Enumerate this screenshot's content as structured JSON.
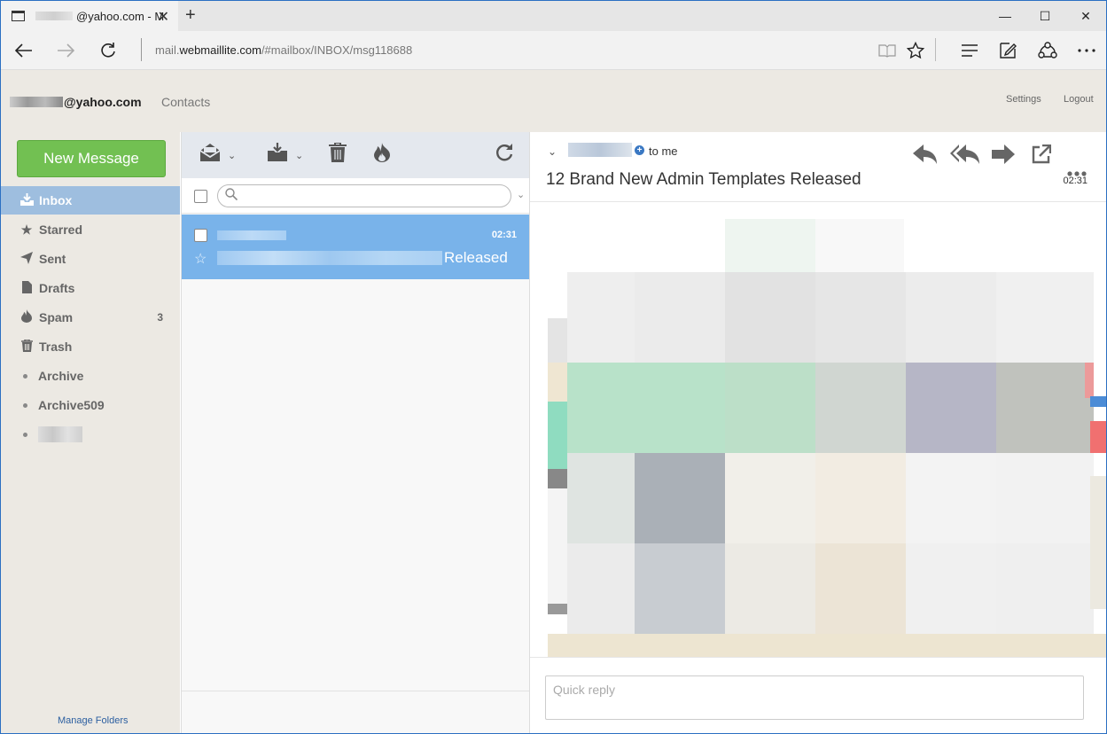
{
  "browser": {
    "tab_title": "@yahoo.com - M",
    "tab_close": "✕",
    "new_tab": "+",
    "window_controls": [
      "—",
      "☐",
      "✕"
    ],
    "address_prefix": "mail.",
    "address_domain": "webmaillite.com",
    "address_path": "/#mailbox/INBOX/msg118688",
    "icons": [
      "back-icon",
      "forward-icon",
      "refresh-icon",
      "reading-view-icon",
      "favorite-star-icon",
      "hub-icon",
      "web-note-icon",
      "share-icon",
      "more-icon"
    ]
  },
  "header": {
    "user_email": "@yahoo.com",
    "contacts": "Contacts",
    "settings": "Settings",
    "logout": "Logout"
  },
  "sidebar": {
    "new_message": "New Message",
    "folders": [
      {
        "label": "Inbox",
        "icon": "inbox-icon",
        "active": true
      },
      {
        "label": "Starred",
        "icon": "star-icon"
      },
      {
        "label": "Sent",
        "icon": "paper-plane-icon"
      },
      {
        "label": "Drafts",
        "icon": "file-icon"
      },
      {
        "label": "Spam",
        "icon": "fire-icon",
        "count": "3"
      },
      {
        "label": "Trash",
        "icon": "trash-icon"
      },
      {
        "label": "Archive",
        "icon": "dot"
      },
      {
        "label": "Archive509",
        "icon": "dot"
      }
    ],
    "manage_folders": "Manage Folders"
  },
  "message_list": {
    "toolbar_icons": [
      "mark-read-icon",
      "move-icon",
      "delete-icon",
      "spam-icon",
      "refresh-icon"
    ],
    "messages": [
      {
        "time": "02:31",
        "subject_suffix": "Released",
        "selected": true
      }
    ]
  },
  "reading_pane": {
    "to": "to me",
    "subject": "12 Brand New Admin Templates Released",
    "time": "02:31",
    "actions": [
      "reply-icon",
      "reply-all-icon",
      "forward-icon",
      "open-external-icon",
      "more-icon"
    ],
    "quick_reply_placeholder": "Quick reply"
  },
  "colors": {
    "accent_blue": "#79b3ea",
    "active_folder": "#9ebedf",
    "new_message_green": "#72c052",
    "header_bg": "#ece9e3"
  }
}
